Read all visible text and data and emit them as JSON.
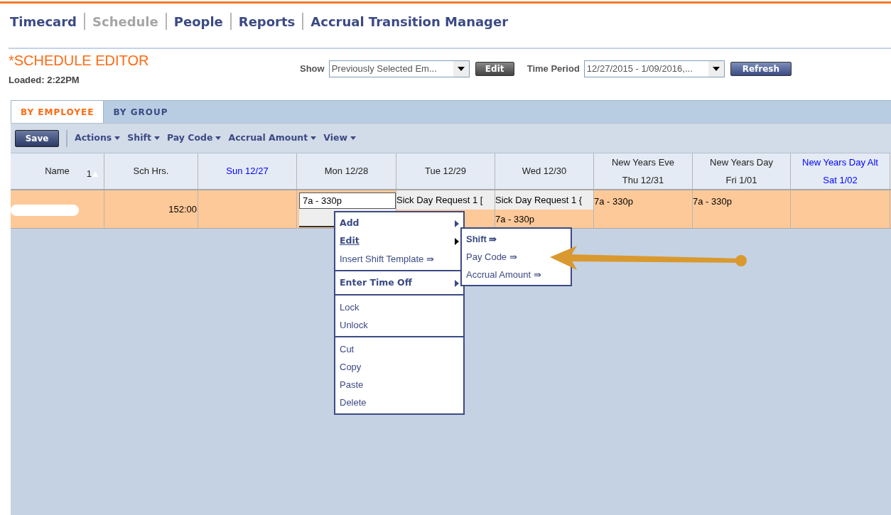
{
  "nav": [
    {
      "label": "Timecard",
      "selected": false
    },
    {
      "label": "Schedule",
      "selected": true
    },
    {
      "label": "People",
      "selected": false
    },
    {
      "label": "Reports",
      "selected": false
    },
    {
      "label": "Accrual Transition Manager",
      "selected": false
    }
  ],
  "editor": {
    "title": "*SCHEDULE EDITOR",
    "loaded": "Loaded: 2:22PM"
  },
  "filters": {
    "show_label": "Show",
    "show_value": "Previously Selected Em...",
    "edit_button": "Edit",
    "period_label": "Time Period",
    "period_value": "12/27/2015 - 1/09/2016,...",
    "refresh_button": "Refresh"
  },
  "tabs": [
    {
      "label": "BY EMPLOYEE",
      "selected": true
    },
    {
      "label": "BY GROUP",
      "selected": false
    }
  ],
  "toolbar": {
    "save_button": "Save",
    "menus": [
      "Actions",
      "Shift",
      "Pay Code",
      "Accrual Amount",
      "View"
    ]
  },
  "table": {
    "columns": [
      {
        "lines": [
          "Name"
        ],
        "sort": "1",
        "highlighted": false
      },
      {
        "lines": [
          "Sch Hrs."
        ],
        "highlighted": false
      },
      {
        "lines": [
          "Sun 12/27"
        ],
        "highlighted": true
      },
      {
        "lines": [
          "Mon 12/28"
        ],
        "highlighted": false
      },
      {
        "lines": [
          "Tue 12/29"
        ],
        "highlighted": false
      },
      {
        "lines": [
          "Wed 12/30"
        ],
        "highlighted": false
      },
      {
        "lines": [
          "New Years Eve",
          "Thu 12/31"
        ],
        "highlighted": false
      },
      {
        "lines": [
          "New Years Day",
          "Fri 1/01"
        ],
        "highlighted": false
      },
      {
        "lines": [
          "New Years Day Alt",
          "Sat 1/02"
        ],
        "highlighted": true
      }
    ],
    "rows": [
      {
        "cells": [
          {
            "kind": "redacted"
          },
          {
            "kind": "number",
            "text": "152:00"
          },
          {
            "kind": "empty"
          },
          {
            "kind": "editing",
            "text": "7a - 330p"
          },
          {
            "kind": "split",
            "top": "Sick Day Request 1 ["
          },
          {
            "kind": "split",
            "top": "Sick Day Request 1 {",
            "bottom": "7a - 330p"
          },
          {
            "kind": "text",
            "text": "7a - 330p"
          },
          {
            "kind": "text",
            "text": "7a - 330p"
          },
          {
            "kind": "empty"
          }
        ]
      }
    ]
  },
  "context_menu": {
    "groups": [
      [
        {
          "label": "Add",
          "bold": true,
          "submenu": true,
          "selected": false
        },
        {
          "label": "Edit",
          "bold": true,
          "submenu": true,
          "selected": true
        },
        {
          "label": "Insert Shift Template ⇛",
          "bold": false,
          "submenu": false,
          "selected": false
        }
      ],
      [
        {
          "label": "Enter Time Off",
          "bold": true,
          "submenu": true,
          "selected": false
        }
      ],
      [
        {
          "label": "Lock",
          "bold": false,
          "submenu": false,
          "selected": false
        },
        {
          "label": "Unlock",
          "bold": false,
          "submenu": false,
          "selected": false
        }
      ],
      [
        {
          "label": "Cut",
          "bold": false,
          "submenu": false,
          "selected": false
        },
        {
          "label": "Copy",
          "bold": false,
          "submenu": false,
          "selected": false
        },
        {
          "label": "Paste",
          "bold": false,
          "submenu": false,
          "selected": false
        },
        {
          "label": "Delete",
          "bold": false,
          "submenu": false,
          "selected": false
        }
      ]
    ]
  },
  "submenu": {
    "items": [
      {
        "label": "Shift ⇛",
        "bold": true
      },
      {
        "label": "Pay Code ⇛",
        "bold": false
      },
      {
        "label": "Accrual Amount ⇛",
        "bold": false
      }
    ]
  }
}
